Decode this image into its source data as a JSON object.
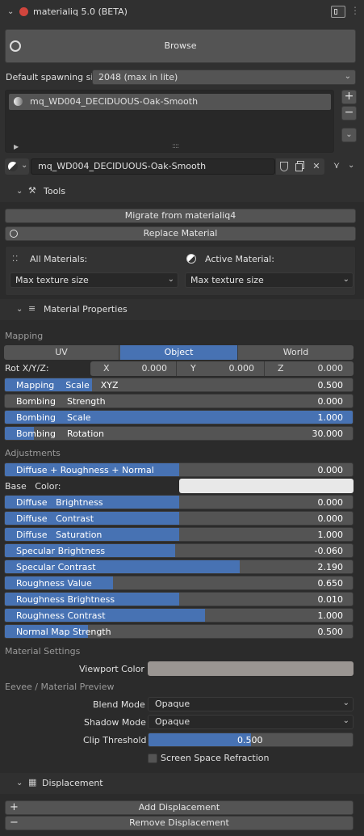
{
  "header": {
    "title": "materialiq 5.0 (BETA)"
  },
  "browse_label": "Browse",
  "spawning": {
    "label": "Default spawning si...",
    "value": "2048 (max in lite)"
  },
  "list": {
    "item": "mq_WD004_DECIDUOUS-Oak-Smooth"
  },
  "material_field": {
    "value": "mq_WD004_DECIDUOUS-Oak-Smooth"
  },
  "tools": {
    "title": "Tools",
    "migrate": "Migrate from materialiq4",
    "replace": "Replace Material",
    "all_materials": "All Materials:",
    "active_material": "Active Material:",
    "all_dropdown": "Max texture size",
    "active_dropdown": "Max texture size"
  },
  "material_properties": {
    "title": "Material Properties"
  },
  "mapping": {
    "section": "Mapping",
    "tabs": [
      "UV",
      "Object",
      "World"
    ],
    "active_tab": "Object",
    "rot_label": "Rot X/Y/Z:",
    "x_label": "X",
    "x_value": "0.000",
    "y_label": "Y",
    "y_value": "0.000",
    "z_label": "Z",
    "z_value": "0.000",
    "sliders": [
      {
        "label": "Mapping    Scale    XYZ",
        "value": "0.500",
        "fill": 0.25
      },
      {
        "label": "Bombing    Strength",
        "value": "0.000",
        "fill": 0.0
      },
      {
        "label": "Bombing    Scale",
        "value": "1.000",
        "fill": 1.0
      },
      {
        "label": "Bombing    Rotation",
        "value": "30.000",
        "fill": 0.083
      }
    ]
  },
  "adjustments": {
    "section": "Adjustments",
    "first": {
      "label": "Diffuse + Roughness + Normal",
      "value": "0.000",
      "fill": 0.5
    },
    "base_color_label": "Base   Color:",
    "sliders": [
      {
        "label": "Diffuse   Brightness",
        "value": "0.000",
        "fill": 0.5
      },
      {
        "label": "Diffuse   Contrast",
        "value": "0.000",
        "fill": 0.5
      },
      {
        "label": "Diffuse   Saturation",
        "value": "1.000",
        "fill": 0.5
      },
      {
        "label": "Specular Brightness",
        "value": "-0.060",
        "fill": 0.49
      },
      {
        "label": "Specular Contrast",
        "value": "2.190",
        "fill": 0.675
      },
      {
        "label": "Roughness Value",
        "value": "0.650",
        "fill": 0.31
      },
      {
        "label": "Roughness Brightness",
        "value": "0.010",
        "fill": 0.5
      },
      {
        "label": "Roughness Contrast",
        "value": "1.000",
        "fill": 0.575
      },
      {
        "label": "Normal Map Strength",
        "value": "0.500",
        "fill": 0.24
      }
    ]
  },
  "material_settings": {
    "section": "Material Settings",
    "viewport_label": "Viewport Color",
    "viewport_color": "#9a9592"
  },
  "eevee": {
    "section": "Eevee / Material Preview",
    "blend_label": "Blend Mode",
    "blend_value": "Opaque",
    "shadow_label": "Shadow Mode",
    "shadow_value": "Opaque",
    "clip_label": "Clip Threshold",
    "clip_value": "0.500",
    "clip_fill": 0.5,
    "ssr_label": "Screen Space Refraction"
  },
  "displacement": {
    "title": "Displacement",
    "add": "Add Displacement",
    "remove": "Remove Displacement"
  },
  "colors": {
    "accent": "#4772b3",
    "base_color": "#e8e8e8"
  }
}
